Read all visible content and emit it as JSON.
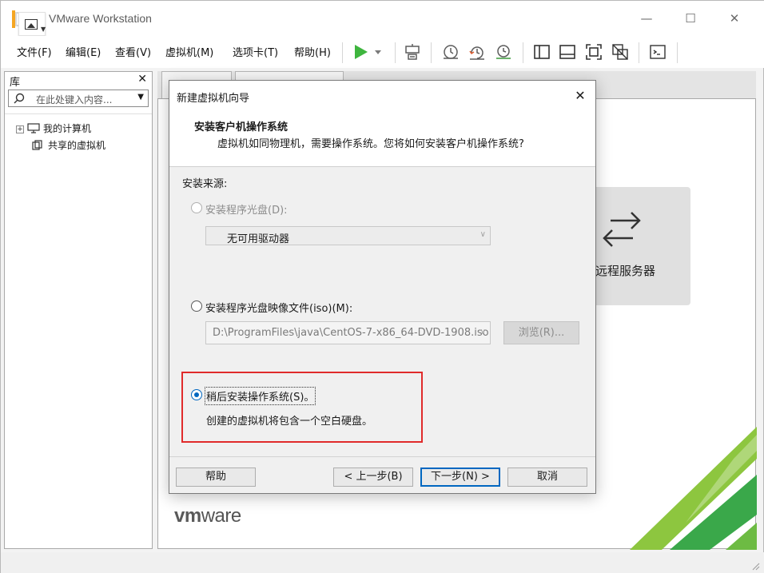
{
  "window": {
    "title": "VMware Workstation",
    "controls": {
      "minimize": "—",
      "maximize": "☐",
      "close": "✕"
    }
  },
  "menu": {
    "items": [
      "文件(F)",
      "编辑(E)",
      "查看(V)",
      "虚拟机(M)",
      "选项卡(T)",
      "帮助(H)"
    ]
  },
  "toolbar": {
    "icons": [
      "power-on-icon",
      "power-dropdown-icon",
      "send-keys-icon",
      "snapshot-icon",
      "revert-snapshot-icon",
      "snapshot-manager-icon",
      "library-view-icon",
      "thumbnail-view-icon",
      "full-screen-icon",
      "unity-icon",
      "console-view-icon"
    ]
  },
  "library": {
    "title": "库",
    "close": "✕",
    "search_placeholder": "在此处键入内容...",
    "tree": [
      {
        "label": "我的计算机",
        "expander": "+"
      },
      {
        "label": "共享的虚拟机"
      }
    ]
  },
  "home": {
    "remote_label": "远程服务器",
    "logo_bold": "vm",
    "logo_rest": "ware"
  },
  "dialog": {
    "title": "新建虚拟机向导",
    "close": "✕",
    "heading": "安装客户机操作系统",
    "subheading": "虚拟机如同物理机，需要操作系统。您将如何安装客户机操作系统?",
    "source_label": "安装来源:",
    "option_disc": {
      "label": "安装程序光盘(D):",
      "selected": false,
      "enabled": false
    },
    "disc_combo_value": "无可用驱动器",
    "option_iso": {
      "label": "安装程序光盘映像文件(iso)(M):",
      "selected": false,
      "enabled": true
    },
    "iso_path": "D:\\ProgramFiles\\java\\CentOS-7-x86_64-DVD-1908.iso",
    "browse_label": "浏览(R)...",
    "option_later": {
      "label": "稍后安装操作系统(S)。",
      "selected": true,
      "enabled": true
    },
    "later_desc": "创建的虚拟机将包含一个空白硬盘。",
    "buttons": {
      "help": "帮助",
      "back": "< 上一步(B)",
      "next": "下一步(N) >",
      "cancel": "取消"
    },
    "highlight_color": "#e02b2b",
    "accent_color": "#0067c0"
  }
}
